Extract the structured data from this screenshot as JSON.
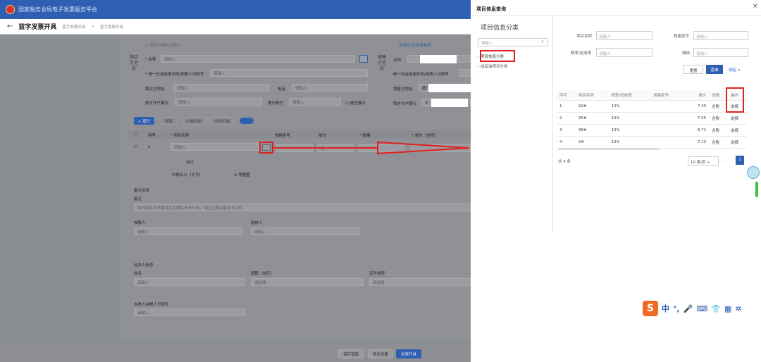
{
  "header": {
    "app_title": "国家税务总局电子发票服务平台"
  },
  "page": {
    "title": "蓝字发票开具",
    "breadcrumb": [
      "蓝字发票开具",
      "蓝字发票开具"
    ]
  },
  "buyer": {
    "side_label": "购买方信息",
    "natural_person_label": "是否开票给自然人",
    "name_label": "* 名称",
    "name_placeholder": "请输入",
    "taxid_label": "* 统一社会信用代码/纳税人识别号",
    "taxid_placeholder": "请输入",
    "address_label": "购买方地址",
    "address_placeholder": "请输入",
    "phone_label": "电话",
    "phone_placeholder": "请输入",
    "bank_label": "购方开户银行",
    "bank_placeholder": "请输入",
    "account_label": "银行账号",
    "account_placeholder": "请输入",
    "show_label": "是否展示"
  },
  "seller": {
    "side_label": "销售方信息",
    "link_label": "查看名称/发票额度",
    "name_label": "名称",
    "taxid_label": "统一社会信用代码/纳税人识别号",
    "address_label": "销售方地址",
    "address_value": "厦门",
    "bank_label": "销方开户银行",
    "bank_value": "中"
  },
  "toolbar": {
    "add_row": "+ 增行",
    "delete": "删除",
    "price_incl": "价格含税",
    "tax_incl": "含税价格"
  },
  "items_table": {
    "headers": [
      "序号",
      "* 项目名称",
      "规格型号",
      "单位",
      "* 数量",
      "* 单价（含税）"
    ],
    "row_index": "1",
    "name_placeholder": "请输入",
    "unit_value": "项",
    "subtotal_label": "合计",
    "total_label": "价税合计（大写）",
    "zero_label": "零圆整"
  },
  "remarks": {
    "section_title": "备注信息",
    "label": "备注",
    "placeholder": "如对购买方开票发生变更后补充开具，也应注意在备注中注明"
  },
  "payee": {
    "label": "收款人",
    "placeholder": "请输入",
    "reviewer_label": "复核人",
    "reviewer_placeholder": "请输入"
  },
  "agent": {
    "section_title": "经办人信息",
    "name_label": "姓名",
    "name_placeholder": "请输入",
    "country_label": "国籍（地区）",
    "country_placeholder": "请选择",
    "idtype_label": "证件类型",
    "idtype_placeholder": "请选择",
    "taxid_label": "自然人纳税人识别号",
    "taxid_placeholder": "请输入"
  },
  "bottom_buttons": {
    "save_draft": "保存草稿",
    "preview": "预览发票",
    "issue": "发票开具"
  },
  "panel": {
    "title": "项目信息查询",
    "close": "×",
    "category_title": "项目信息分类",
    "search_placeholder": "请输入",
    "tree": [
      "项目信息分类",
      "成品油项目分类"
    ],
    "filters": {
      "name_label": "项目名称",
      "name_placeholder": "请输入",
      "spec_label": "规格型号",
      "spec_placeholder": "请输入",
      "rate_label": "税率/征收率",
      "rate_placeholder": "请输入",
      "short_label": "简码",
      "short_placeholder": "请输入"
    },
    "reset": "重置",
    "query": "查询",
    "collapse": "收起 ∧",
    "table_headers": [
      "序号",
      "项目名称",
      "税率/征收率",
      "规格型号",
      "单价",
      "含税",
      "操作"
    ],
    "rows": [
      {
        "idx": "1",
        "name": "92#",
        "rate": "13%",
        "spec": "",
        "price": "7.45",
        "tax": "含税",
        "action": "选择"
      },
      {
        "idx": "2",
        "name": "95#",
        "rate": "13%",
        "spec": "",
        "price": "7.95",
        "tax": "含税",
        "action": "选择"
      },
      {
        "idx": "3",
        "name": "98#",
        "rate": "13%",
        "spec": "",
        "price": "8.71",
        "tax": "含税",
        "action": "选择"
      },
      {
        "idx": "4",
        "name": "0#",
        "rate": "13%",
        "spec": "",
        "price": "7.13",
        "tax": "含税",
        "action": "选择"
      }
    ],
    "total_text": "共 4 条",
    "page_size": "10 条/页",
    "current_page": "1"
  },
  "ime": {
    "cn": "中",
    "punct": "°,",
    "mic": "🎤",
    "keyboard": "⌨",
    "shirt": "👕",
    "grid": "▦",
    "gear": "✲"
  },
  "colors": {
    "primary": "#2f5fb3",
    "highlight": "#e02020"
  }
}
